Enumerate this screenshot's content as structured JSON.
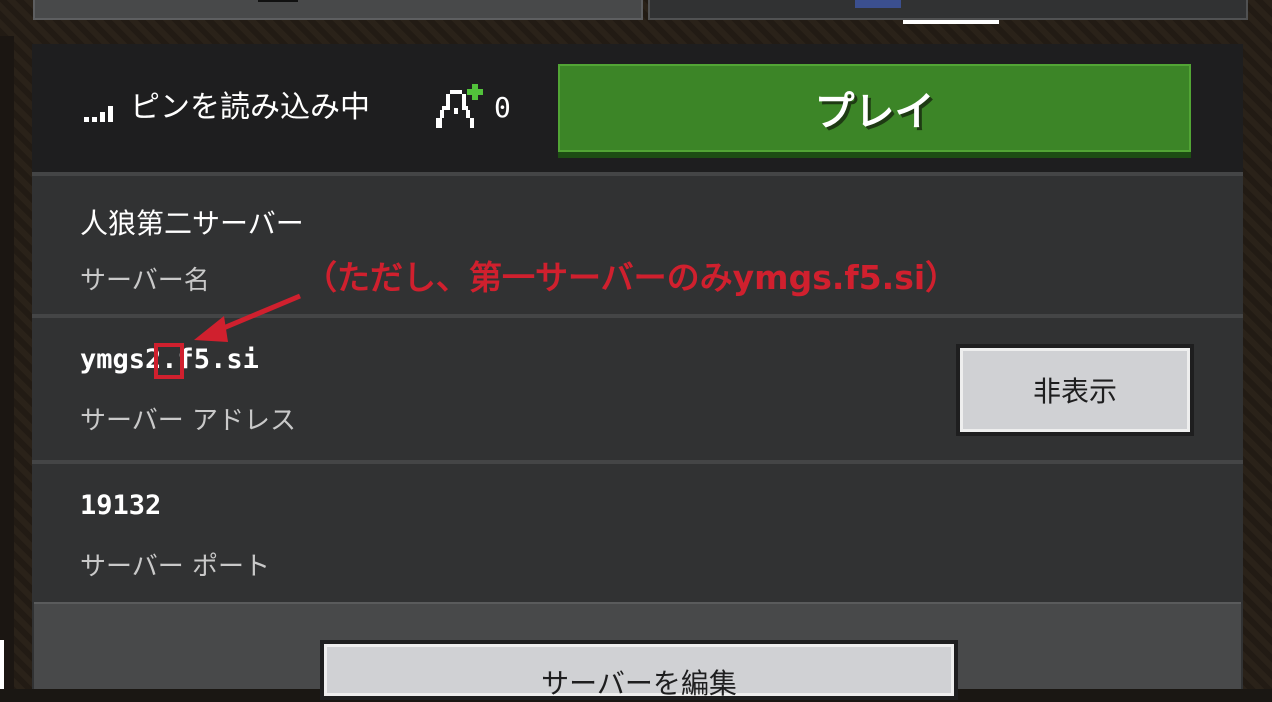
{
  "header": {
    "ping_status": "ピンを読み込み中",
    "player_count": "0",
    "play_label": "プレイ"
  },
  "server_name": {
    "value": "人狼第二サーバー",
    "label": "サーバー名"
  },
  "server_address": {
    "value_prefix": "ymgs",
    "value_highlight": "2",
    "value_suffix": ".f5.si",
    "label": "サーバー アドレス",
    "hide_label": "非表示"
  },
  "server_port": {
    "value": "19132",
    "label": "サーバー ポート"
  },
  "footer": {
    "edit_label": "サーバーを編集"
  },
  "annotation": {
    "text": "（ただし、第一サーバーのみymgs.f5.si）",
    "color": "#d0202e"
  },
  "colors": {
    "play_green": "#3c8527",
    "panel": "#313233",
    "header": "#1e1e1f",
    "button_gray": "#d0d1d4"
  },
  "icons": {
    "signal": "signal-bars-icon",
    "players": "add-player-icon"
  }
}
